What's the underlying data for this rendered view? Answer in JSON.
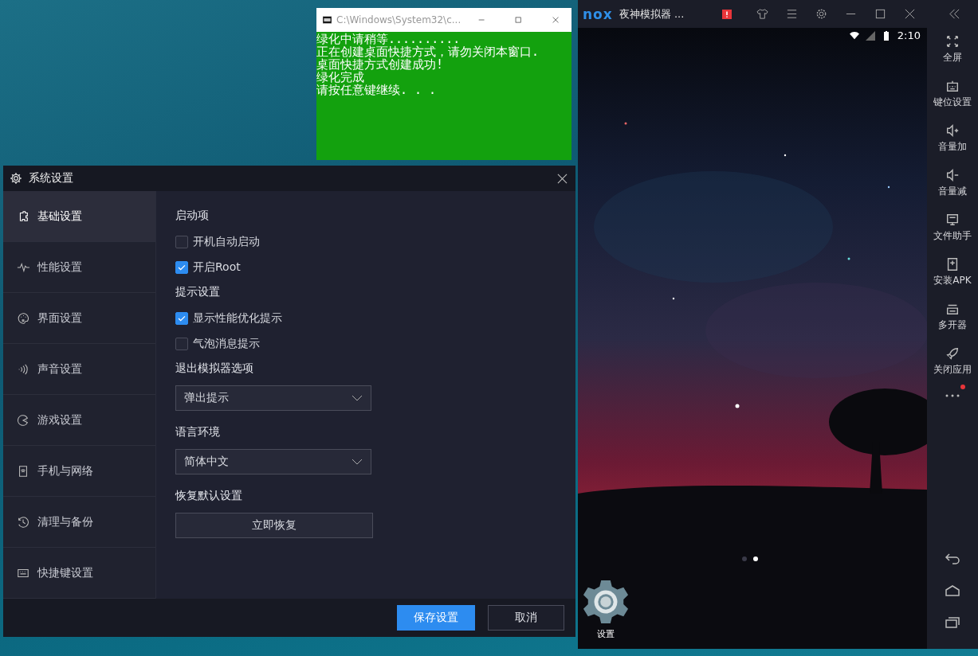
{
  "cmd_window": {
    "title": "C:\\Windows\\System32\\c...",
    "lines": [
      "绿化中请稍等..........",
      "正在创建桌面快捷方式，请勿关闭本窗口.",
      "桌面快捷方式创建成功!",
      "绿化完成",
      "请按任意键继续. . ."
    ]
  },
  "settings_window": {
    "title": "系统设置",
    "nav": [
      {
        "label": "基础设置",
        "selected": true
      },
      {
        "label": "性能设置",
        "selected": false
      },
      {
        "label": "界面设置",
        "selected": false
      },
      {
        "label": "声音设置",
        "selected": false
      },
      {
        "label": "游戏设置",
        "selected": false
      },
      {
        "label": "手机与网络",
        "selected": false
      },
      {
        "label": "清理与备份",
        "selected": false
      },
      {
        "label": "快捷键设置",
        "selected": false
      }
    ],
    "sections": [
      {
        "heading": "启动项",
        "kind": "checkboxes",
        "options": [
          {
            "label": "开机自动启动",
            "checked": false
          },
          {
            "label": "开启Root",
            "checked": true
          }
        ]
      },
      {
        "heading": "提示设置",
        "kind": "checkboxes",
        "options": [
          {
            "label": "显示性能优化提示",
            "checked": true
          },
          {
            "label": "气泡消息提示",
            "checked": false
          }
        ]
      },
      {
        "heading": "退出模拟器选项",
        "kind": "dropdown",
        "value": "弹出提示"
      },
      {
        "heading": "语言环境",
        "kind": "dropdown",
        "value": "简体中文"
      },
      {
        "heading": "恢复默认设置",
        "kind": "button",
        "label": "立即恢复"
      }
    ],
    "buttons": [
      {
        "label": "保存设置",
        "kind": "primary"
      },
      {
        "label": "取消",
        "kind": "secondary"
      }
    ]
  },
  "emulator": {
    "logo": "nox",
    "title": "夜神模拟器 ...",
    "clock": "2:10",
    "page_dots": [
      {
        "selected": false
      },
      {
        "selected": true
      }
    ],
    "apps": [
      {
        "label": "设置"
      }
    ],
    "tools": [
      {
        "label": "全屏"
      },
      {
        "label": "键位设置"
      },
      {
        "label": "音量加"
      },
      {
        "label": "音量减"
      },
      {
        "label": "文件助手"
      },
      {
        "label": "安装APK"
      },
      {
        "label": "多开器"
      },
      {
        "label": "关闭应用"
      }
    ],
    "more_notification": true
  }
}
